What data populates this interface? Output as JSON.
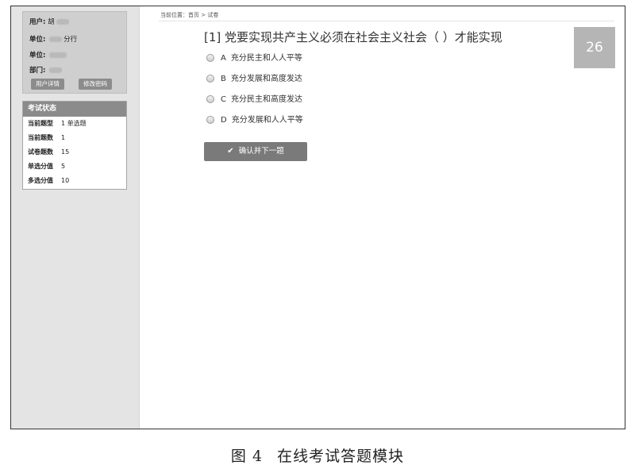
{
  "user_box": {
    "user_label": "用户:",
    "user_value": "胡",
    "unit_label": "单位:",
    "unit_value": "分行",
    "unit2_label": "单位:",
    "dept_label": "部门:",
    "detail_button": "用户详情",
    "change_pwd_button": "修改密码"
  },
  "status": {
    "header": "考试状态",
    "rows": [
      {
        "key": "当前题型",
        "value": "1 单选题"
      },
      {
        "key": "当前题数",
        "value": "1"
      },
      {
        "key": "试卷题数",
        "value": "15"
      },
      {
        "key": "单选分值",
        "value": "5"
      },
      {
        "key": "多选分值",
        "value": "10"
      }
    ]
  },
  "breadcrumb": "当前位置：首页 > 试卷",
  "question": {
    "text": "[1] 党要实现共产主义必须在社会主义社会（ ）才能实现",
    "options": [
      {
        "letter": "A",
        "text": "充分民主和人人平等"
      },
      {
        "letter": "B",
        "text": "充分发展和高度发达"
      },
      {
        "letter": "C",
        "text": "充分民主和高度发达"
      },
      {
        "letter": "D",
        "text": "充分发展和人人平等"
      }
    ]
  },
  "counter": "26",
  "confirm_button": "确认并下一题",
  "icons": {
    "confirm": "check-icon"
  },
  "caption": {
    "number": "图 4",
    "title": "在线考试答题模块"
  }
}
